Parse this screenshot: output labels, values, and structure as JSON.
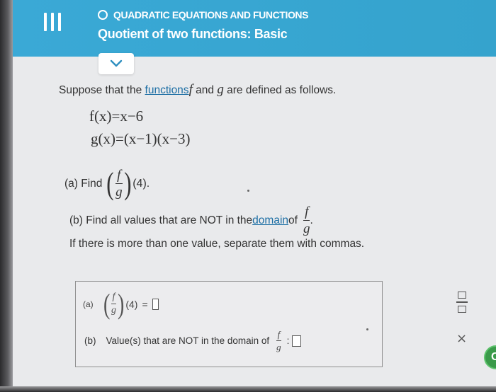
{
  "header": {
    "topic": "QUADRATIC EQUATIONS AND FUNCTIONS",
    "title": "Quotient of two functions: Basic"
  },
  "problem": {
    "intro_before": "Suppose that the ",
    "intro_link": "functions",
    "intro_after": " and ",
    "intro_end": " are defined as follows.",
    "f_name": "f",
    "g_name": "g",
    "f_def": "f(x)=x−6",
    "g_def": "g(x)=(x−1)(x−3)",
    "part_a_label": "(a) Find",
    "part_a_arg": "(4).",
    "part_b_before": "(b) Find all values that are NOT in the ",
    "part_b_link": "domain",
    "part_b_after": " of",
    "instruction": "If there is more than one value, separate them with commas."
  },
  "answers": {
    "a_label": "(a)",
    "a_arg": "(4)",
    "a_eq": "=",
    "b_label": "(b)",
    "b_text": "Value(s) that are NOT in the domain of",
    "b_colon": ":"
  },
  "tools": {
    "close": "×",
    "help": "C"
  },
  "colors": {
    "header": "#38a7d3",
    "link": "#1c6ea4",
    "help_button": "#3a9a4a"
  }
}
